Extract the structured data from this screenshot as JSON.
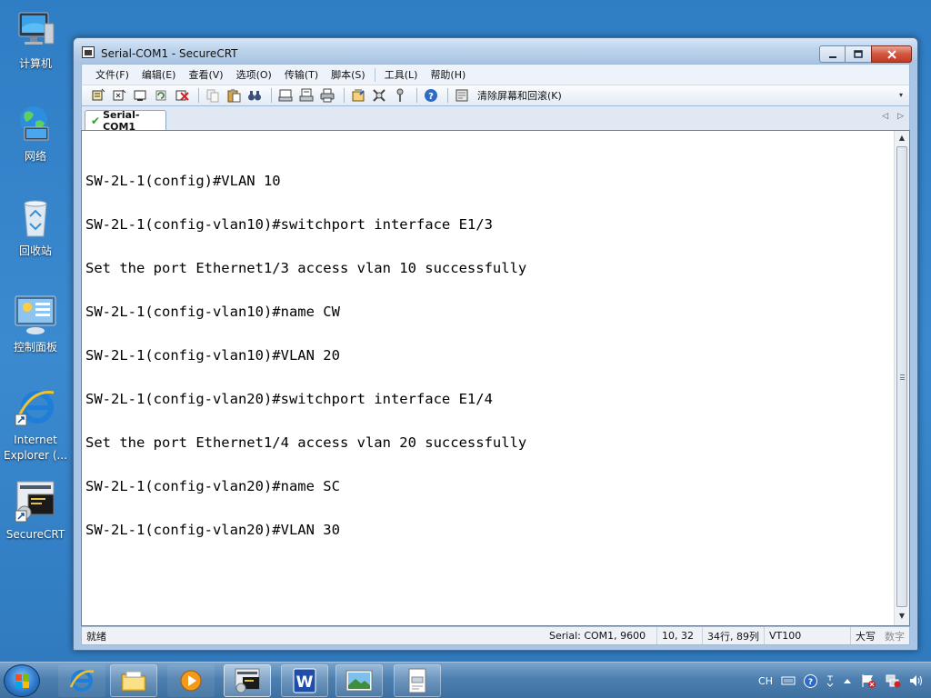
{
  "desktop": {
    "icons": [
      {
        "label": "计算机"
      },
      {
        "label": "网络"
      },
      {
        "label": "回收站"
      },
      {
        "label": "控制面板"
      },
      {
        "label": "Internet Explorer (..."
      },
      {
        "label": "SecureCRT"
      }
    ]
  },
  "window": {
    "title": "Serial-COM1 - SecureCRT",
    "controls": {
      "minimize": "—",
      "maximize": "▭",
      "close": "✕"
    }
  },
  "menu": {
    "items": [
      {
        "label": "文件(F)"
      },
      {
        "label": "编辑(E)"
      },
      {
        "label": "查看(V)"
      },
      {
        "label": "选项(O)"
      },
      {
        "label": "传输(T)"
      },
      {
        "label": "脚本(S)"
      },
      {
        "label": "工具(L)"
      },
      {
        "label": "帮助(H)"
      }
    ]
  },
  "toolbar": {
    "clear_label": "清除屏幕和回滚(K)"
  },
  "tabs": [
    {
      "label": "Serial-COM1",
      "active": true
    }
  ],
  "terminal": {
    "lines": [
      "SW-2L-1(config)#VLAN 10",
      "SW-2L-1(config-vlan10)#switchport interface E1/3",
      "Set the port Ethernet1/3 access vlan 10 successfully",
      "SW-2L-1(config-vlan10)#name CW",
      "SW-2L-1(config-vlan10)#VLAN 20",
      "SW-2L-1(config-vlan20)#switchport interface E1/4",
      "Set the port Ethernet1/4 access vlan 20 successfully",
      "SW-2L-1(config-vlan20)#name SC",
      "SW-2L-1(config-vlan20)#VLAN 30"
    ]
  },
  "status": {
    "ready": "就绪",
    "connection": "Serial: COM1, 9600",
    "cursor": "10,  32",
    "size": "34行, 89列",
    "emulation": "VT100",
    "caps": "大写",
    "num": "数字"
  },
  "tray": {
    "lang": "CH"
  }
}
